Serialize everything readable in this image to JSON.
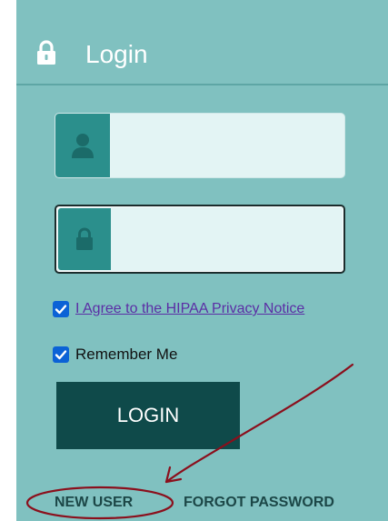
{
  "header": {
    "title": "Login",
    "icon": "lock-icon"
  },
  "fields": {
    "username": {
      "icon": "user-icon",
      "value": ""
    },
    "password": {
      "icon": "lock-icon",
      "value": ""
    }
  },
  "agree": {
    "checked": true,
    "label": "I Agree to the HIPAA Privacy Notice"
  },
  "remember": {
    "checked": true,
    "label": "Remember Me"
  },
  "login_button": {
    "label": "LOGIN"
  },
  "links": {
    "new_user": "NEW USER",
    "forgot_password": "FORGOT PASSWORD"
  },
  "colors": {
    "panel": "#80c1c0",
    "icon_bg": "#2b8f8c",
    "button": "#0f4a4a",
    "annotation": "#8b0f1c"
  }
}
